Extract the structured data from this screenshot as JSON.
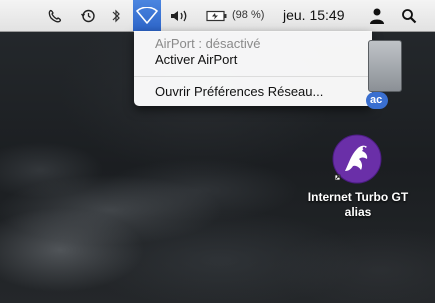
{
  "menubar": {
    "battery_text": "(98 %)",
    "clock": "jeu. 15:49"
  },
  "airport_menu": {
    "status": "AirPort : désactivé",
    "turn_on": "Activer AirPort",
    "open_prefs": "Ouvrir Préférences Réseau..."
  },
  "desktop": {
    "hd_label_partial": "ac",
    "alias_label_line1": "Internet Turbo GT",
    "alias_label_line2": "alias"
  },
  "colors": {
    "menu_highlight": "#3b74d6",
    "alias_icon_purple": "#6a2fa8"
  }
}
